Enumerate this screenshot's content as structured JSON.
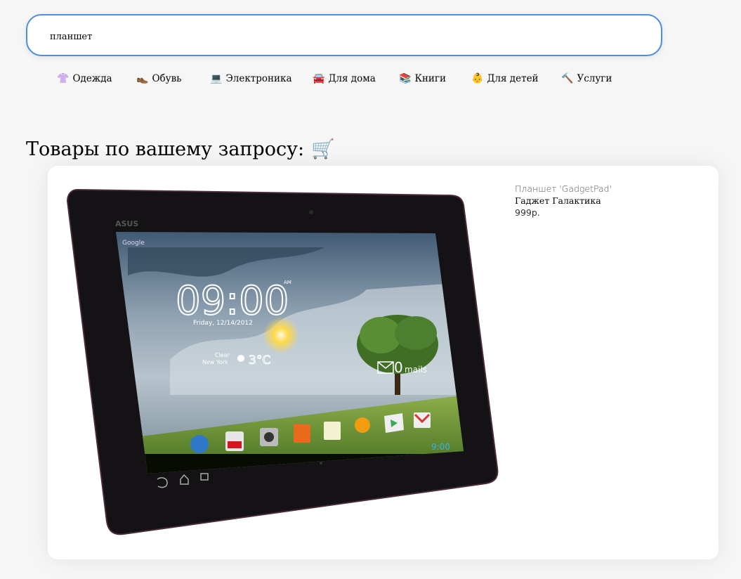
{
  "search": {
    "value": "планшет"
  },
  "categories": [
    {
      "icon": "shirt-icon",
      "glyph": "👚",
      "label": "Одежда"
    },
    {
      "icon": "shoe-icon",
      "glyph": "👞",
      "label": "Обувь"
    },
    {
      "icon": "laptop-icon",
      "glyph": "💻",
      "label": "Электроника"
    },
    {
      "icon": "car-icon",
      "glyph": "🚘",
      "label": "Для дома"
    },
    {
      "icon": "books-icon",
      "glyph": "📚",
      "label": "Книги"
    },
    {
      "icon": "baby-icon",
      "glyph": "👶",
      "label": "Для детей"
    },
    {
      "icon": "hammer-icon",
      "glyph": "🔨",
      "label": "Услуги"
    }
  ],
  "results": {
    "heading": "Товары по вашему запросу:",
    "heading_icon": "cart-icon"
  },
  "product": {
    "name": "Планшет 'GadgetPad'",
    "seller": "Гаджет Галактика",
    "price": "999р.",
    "screen": {
      "brand": "ASUS",
      "search_label": "Google",
      "clock": "09:00",
      "ampm": "AM",
      "date": "Friday, 12/14/2012",
      "weather_condition": "Clear",
      "city": "New York",
      "temperature": "3°C",
      "mail_count": "0",
      "mail_label": "mails",
      "status_time": "9:00",
      "apps": [
        "Browser",
        "YouTube",
        "Camera",
        "Gallery",
        "SuperNote Lite",
        "Play Music",
        "Play Store",
        "Gmail"
      ]
    }
  }
}
